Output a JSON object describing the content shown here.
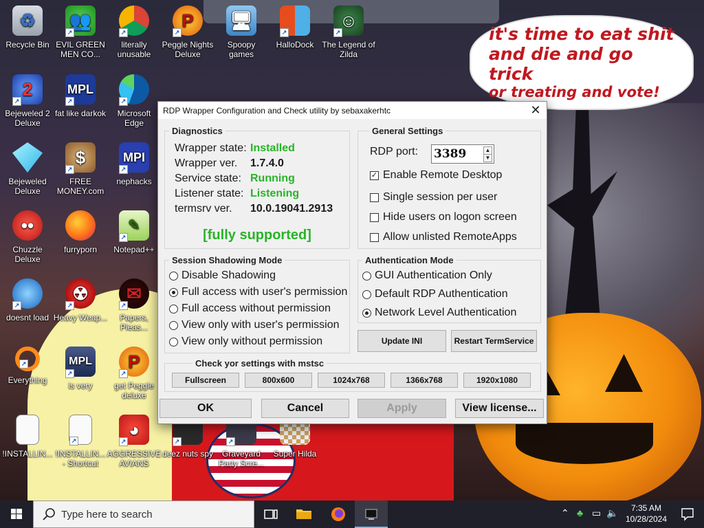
{
  "desktop": {
    "icons": [
      {
        "label": "Recycle Bin",
        "icon": "recycle-bin-icon"
      },
      {
        "label": "EVIL GREEN MEN CO...",
        "icon": "users-icon"
      },
      {
        "label": "literally unusable",
        "icon": "chrome-icon"
      },
      {
        "label": "Peggle Nights Deluxe",
        "icon": "peggle-icon"
      },
      {
        "label": "Spoopy games",
        "icon": "network-computers-icon"
      },
      {
        "label": "HalloDock",
        "icon": "dock-icon"
      },
      {
        "label": "The Legend of Zilda",
        "icon": "zelda-icon"
      },
      {
        "label": "Bejeweled 2 Deluxe",
        "icon": "bejeweled-icon"
      },
      {
        "label": "fat like darkok",
        "icon": "mpl-icon"
      },
      {
        "label": "Microsoft Edge",
        "icon": "edge-icon"
      },
      {
        "label": "Bejeweled Deluxe",
        "icon": "gem-icon"
      },
      {
        "label": "FREE MONEY.com",
        "icon": "money-bag-icon"
      },
      {
        "label": "nephacks",
        "icon": "mpi-icon"
      },
      {
        "label": "Chuzzle Deluxe",
        "icon": "chuzzle-icon"
      },
      {
        "label": "furryporn",
        "icon": "firefox-icon"
      },
      {
        "label": "Notepad++",
        "icon": "notepad-icon"
      },
      {
        "label": "doesnt load",
        "icon": "thunderbird-icon"
      },
      {
        "label": "Heavy Weap...",
        "icon": "radiation-icon"
      },
      {
        "label": "Papers, Pleas...",
        "icon": "papers-please-icon"
      },
      {
        "label": "Everything",
        "icon": "search-ring-icon"
      },
      {
        "label": "is very",
        "icon": "mpl-shield-icon"
      },
      {
        "label": "get Peggle deluxe",
        "icon": "peggle-icon"
      },
      {
        "label": "!INSTALLIN...",
        "icon": "document-icon"
      },
      {
        "label": "!INSTALLIN... - Shortcut",
        "icon": "document-icon"
      },
      {
        "label": "AGGRESSIVE AVIANS",
        "icon": "angry-bird-icon"
      },
      {
        "label": "deez nuts spy",
        "icon": "app-icon"
      },
      {
        "label": "Graveyard Party Scre...",
        "icon": "graveyard-icon"
      },
      {
        "label": "Super Hilda",
        "icon": "game-icon"
      }
    ]
  },
  "wallpaper": {
    "bubble_lines": [
      "it's time to eat shit",
      "and die and go trick",
      "or treating and vote!"
    ]
  },
  "dialog": {
    "title": "RDP Wrapper Configuration and Check utility by sebaxakerhtc",
    "diagnostics": {
      "title": "Diagnostics",
      "rows": [
        {
          "label": "Wrapper state:",
          "value": "Installed",
          "color": "#28b428"
        },
        {
          "label": "Wrapper ver.",
          "value": "1.7.4.0",
          "color": "#1a1a1a"
        },
        {
          "label": "Service state:",
          "value": "Running",
          "color": "#28b428"
        },
        {
          "label": "Listener state:",
          "value": "Listening",
          "color": "#28b428"
        },
        {
          "label": "termsrv ver.",
          "value": "10.0.19041.2913",
          "color": "#1a1a1a"
        }
      ],
      "support_status": "[fully supported]"
    },
    "general": {
      "title": "General Settings",
      "rdp_port_label": "RDP port:",
      "rdp_port_value": "3389",
      "options": [
        {
          "label": "Enable Remote Desktop",
          "checked": true
        },
        {
          "label": "Single session per user",
          "checked": false
        },
        {
          "label": "Hide users on logon screen",
          "checked": false
        },
        {
          "label": "Allow unlisted RemoteApps",
          "checked": false
        }
      ]
    },
    "shadowing": {
      "title": "Session Shadowing Mode",
      "options": [
        {
          "label": "Disable Shadowing",
          "selected": false
        },
        {
          "label": "Full access with user's permission",
          "selected": true
        },
        {
          "label": "Full access without permission",
          "selected": false
        },
        {
          "label": "View only with user's permission",
          "selected": false
        },
        {
          "label": "View only without permission",
          "selected": false
        }
      ]
    },
    "auth": {
      "title": "Authentication Mode",
      "options": [
        {
          "label": "GUI Authentication Only",
          "selected": false
        },
        {
          "label": "Default RDP Authentication",
          "selected": false
        },
        {
          "label": "Network Level Authentication",
          "selected": true
        }
      ]
    },
    "update_ini": "Update INI",
    "restart_termservice": "Restart TermService",
    "mstsc": {
      "title": "Check yor settings with mstsc",
      "buttons": [
        "Fullscreen",
        "800x600",
        "1024x768",
        "1366x768",
        "1920x1080"
      ]
    },
    "ok": "OK",
    "cancel": "Cancel",
    "apply": "Apply",
    "view_license": "View license..."
  },
  "taskbar": {
    "search_placeholder": "Type here to search",
    "time": "7:35 AM",
    "date": "10/28/2024"
  },
  "colors": {
    "green_status": "#28b428",
    "taskbar": "#20202a",
    "bubble_text": "#c01820"
  }
}
